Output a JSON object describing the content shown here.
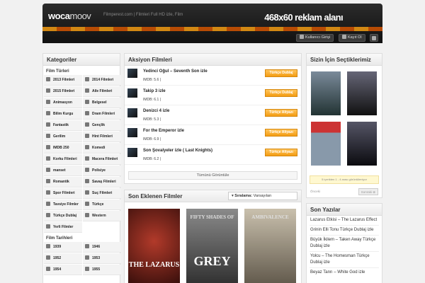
{
  "header": {
    "logo_a": "woca",
    "logo_b": "moov",
    "tagline": "Filmperest.com | Filmleri Full HD izle, Film",
    "ad": "468x60 reklam alanı",
    "login": "Kullanıcı Girişi",
    "register": "Kayıt Ol"
  },
  "categories": {
    "title": "Kategoriler",
    "types_title": "Film Türleri",
    "items": [
      "2013 Filmleri",
      "2014 Filmleri",
      "2015 Filmleri",
      "Aile Filmleri",
      "Animasyon",
      "Belgesel",
      "Bilim Kurgu",
      "Dram Filmleri",
      "Fantastik",
      "Gençlik",
      "Gerilim",
      "Hint Filmleri",
      "IMDB 250",
      "Komedi",
      "Korku Filmleri",
      "Macera Filmleri",
      "manset",
      "Polisiye",
      "Romantik",
      "Savaş Filmleri",
      "Spor Filmleri",
      "Suç Filmleri",
      "Tavsiye Filmler",
      "Türkçe",
      "Türkçe Dublaj",
      "Western",
      "Yerli Filmler"
    ],
    "years_title": "Film Tarihleri",
    "years": [
      "1939",
      "1946",
      "1952",
      "1953",
      "1954",
      "1955"
    ]
  },
  "action": {
    "title": "Aksiyon Filmleri",
    "movies": [
      {
        "title": "Yedinci Oğul – Seventh Son izle",
        "imdb": "IMDB: 5.6 |",
        "tag": "Türkçe Dublaj"
      },
      {
        "title": "Takip 3 izle",
        "imdb": "IMDB: 6.1 |",
        "tag": "Türkçe Dublaj"
      },
      {
        "title": "Denizci 4 izle",
        "imdb": "IMDB: 5.3 |",
        "tag": "Türkçe Altyazı"
      },
      {
        "title": "For the Emperor izle",
        "imdb": "IMDB: 6.9 |",
        "tag": "Türkçe Altyazı"
      },
      {
        "title": "Son Şovalyeler izle ( Last Knights)",
        "imdb": "IMDB: 6.2 |",
        "tag": "Türkçe Altyazı"
      }
    ],
    "show_all": "Tümünü Görüntüle"
  },
  "recent": {
    "title": "Son Eklenen Filmler",
    "sort_label": "Sıralama:",
    "sort_value": "Varsayılan",
    "posters": [
      {
        "text": "THE LAZARUS",
        "top": ""
      },
      {
        "text": "GREY",
        "top": "FIFTY SHADES OF"
      },
      {
        "text": "",
        "top": "AMBIVALENCE"
      }
    ]
  },
  "picks": {
    "title": "Sizin İçin Seçtiklerimiz",
    "note": "5 içerikten 1 - 4 arası görüntüleniyor",
    "prev": "Önceki",
    "next": "Sonraki"
  },
  "posts": {
    "title": "Son Yazılar",
    "items": [
      "Lazarus Etkisi – The Lazarus Effect",
      "Grinin Elli Tonu Türkçe Dublaj izle",
      "Büyük İkilem – Taken Away Türkçe Dublaj izle",
      "Yolcu – The Homesman Türkçe Dublaj izle",
      "Beyaz Tanrı – White God izle"
    ]
  },
  "colors": {
    "accent": "#f39c12",
    "header": "#1a1a1a"
  }
}
